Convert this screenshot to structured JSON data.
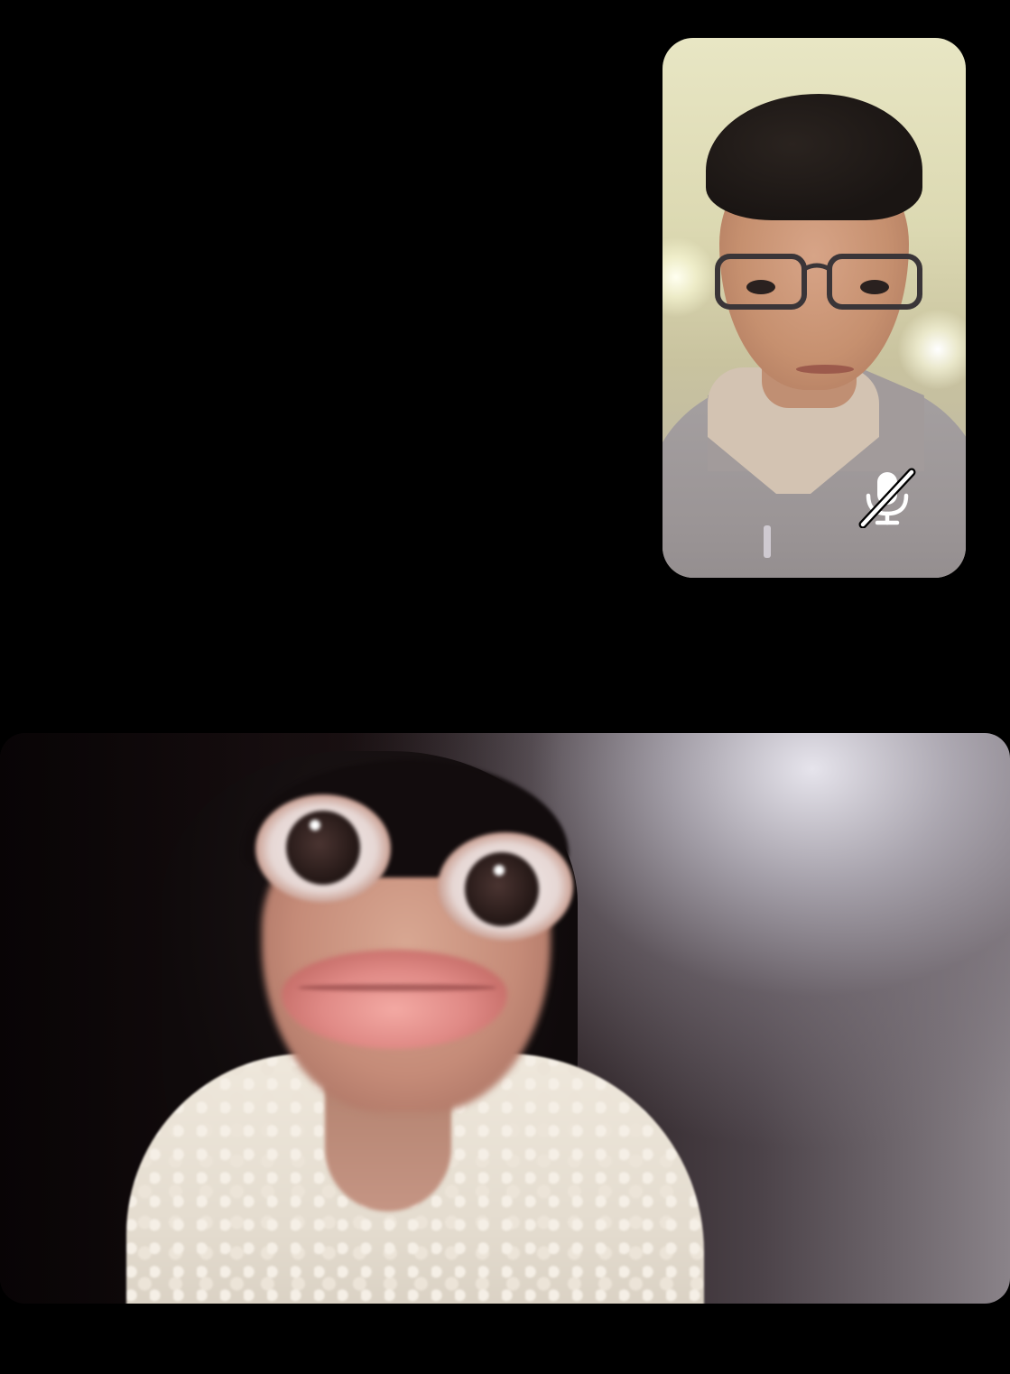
{
  "call": {
    "self_view": {
      "label": "",
      "muted": true,
      "mute_icon": "mic-slash-icon"
    },
    "remote_view": {
      "label": ""
    }
  },
  "colors": {
    "background": "#000000",
    "mute_icon": "#ffffff"
  }
}
